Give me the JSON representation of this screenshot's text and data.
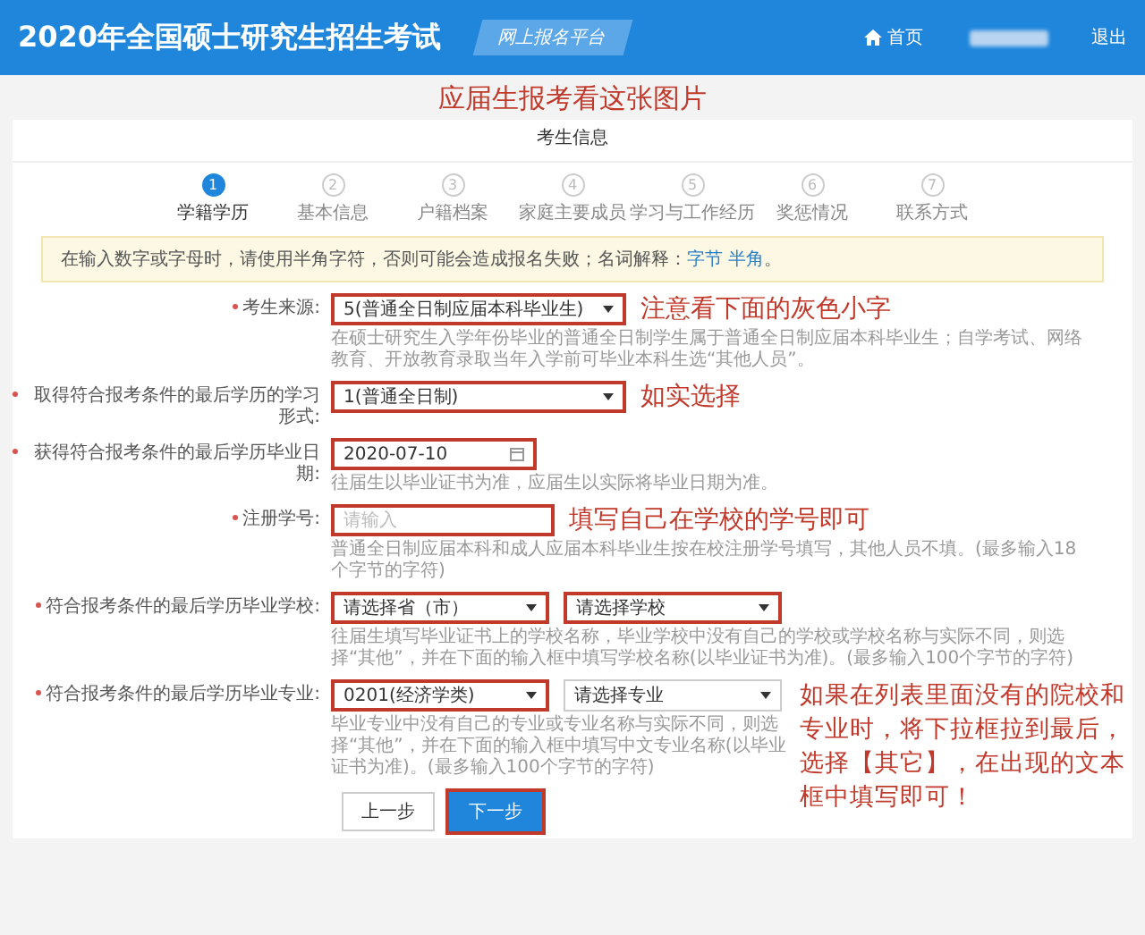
{
  "header": {
    "title": "2020年全国硕士研究生招生考试",
    "platform": "网上报名平台",
    "home": "首页",
    "logout": "退出"
  },
  "banner_note": "应届生报考看这张图片",
  "card_title": "考生信息",
  "steps": [
    {
      "number": "1",
      "label": "学籍学历",
      "selected": true
    },
    {
      "number": "2",
      "label": "基本信息",
      "selected": false
    },
    {
      "number": "3",
      "label": "户籍档案",
      "selected": false
    },
    {
      "number": "4",
      "label": "家庭主要成员",
      "selected": false
    },
    {
      "number": "5",
      "label": "学习与工作经历",
      "selected": false
    },
    {
      "number": "6",
      "label": "奖惩情况",
      "selected": false
    },
    {
      "number": "7",
      "label": "联系方式",
      "selected": false
    }
  ],
  "notice": {
    "text": "在输入数字或字母时，请使用半角字符，否则可能会造成报名失败；名词解释：",
    "links": [
      "字节",
      "半角"
    ],
    "end": "。"
  },
  "fields": [
    {
      "label": "考生来源:",
      "required": true,
      "controls": [
        {
          "kind": "select",
          "value": "5(普通全日制应届本科毕业生)",
          "highlighted": true
        }
      ],
      "annotation": "注意看下面的灰色小字",
      "hint": "在硕士研究生入学年份毕业的普通全日制学生属于普通全日制应届本科毕业生；自学考试、网络教育、开放教育录取当年入学前可毕业本科生选“其他人员”。"
    },
    {
      "label": "取得符合报考条件的最后学历的学习形式:",
      "required": true,
      "controls": [
        {
          "kind": "select",
          "value": "1(普通全日制)",
          "highlighted": true
        }
      ],
      "annotation": "如实选择"
    },
    {
      "label": "获得符合报考条件的最后学历毕业日期:",
      "required": true,
      "controls": [
        {
          "kind": "date",
          "value": "2020-07-10",
          "highlighted": true
        }
      ],
      "hint": "往届生以毕业证书为准，应届生以实际将毕业日期为准。"
    },
    {
      "label": "注册学号:",
      "required": true,
      "controls": [
        {
          "kind": "text",
          "placeholder": "请输入",
          "highlighted": true
        }
      ],
      "annotation": "填写自己在学校的学号即可",
      "hint": "普通全日制应届本科和成人应届本科毕业生按在校注册学号填写，其他人员不填。(最多输入18个字节的字符)"
    },
    {
      "label": "符合报考条件的最后学历毕业学校:",
      "required": true,
      "controls": [
        {
          "kind": "select",
          "value": "请选择省（市）",
          "highlighted": true
        },
        {
          "kind": "select",
          "value": "请选择学校",
          "highlighted": true
        }
      ],
      "hint": "往届生填写毕业证书上的学校名称，毕业学校中没有自己的学校或学校名称与实际不同，则选择“其他”，并在下面的输入框中填写学校名称(以毕业证书为准)。(最多输入100个字节的字符)"
    },
    {
      "label": "符合报考条件的最后学历毕业专业:",
      "required": true,
      "controls": [
        {
          "kind": "select",
          "value": "0201(经济学类)",
          "highlighted": true
        },
        {
          "kind": "select",
          "value": "请选择专业",
          "highlighted": false
        }
      ],
      "annotation": "如果在列表里面没有的院校和专业时，将下拉框拉到最后，选择【其它】，在出现的文本框中填写即可！",
      "hint": "毕业专业中没有自己的专业或专业名称与实际不同，则选择“其他”，并在下面的输入框中填写中文专业名称(以毕业证书为准)。(最多输入100个字节的字符)"
    }
  ],
  "buttons": [
    {
      "label": "上一步",
      "primary": false,
      "highlighted": false
    },
    {
      "label": "下一步",
      "primary": true,
      "highlighted": true
    }
  ]
}
